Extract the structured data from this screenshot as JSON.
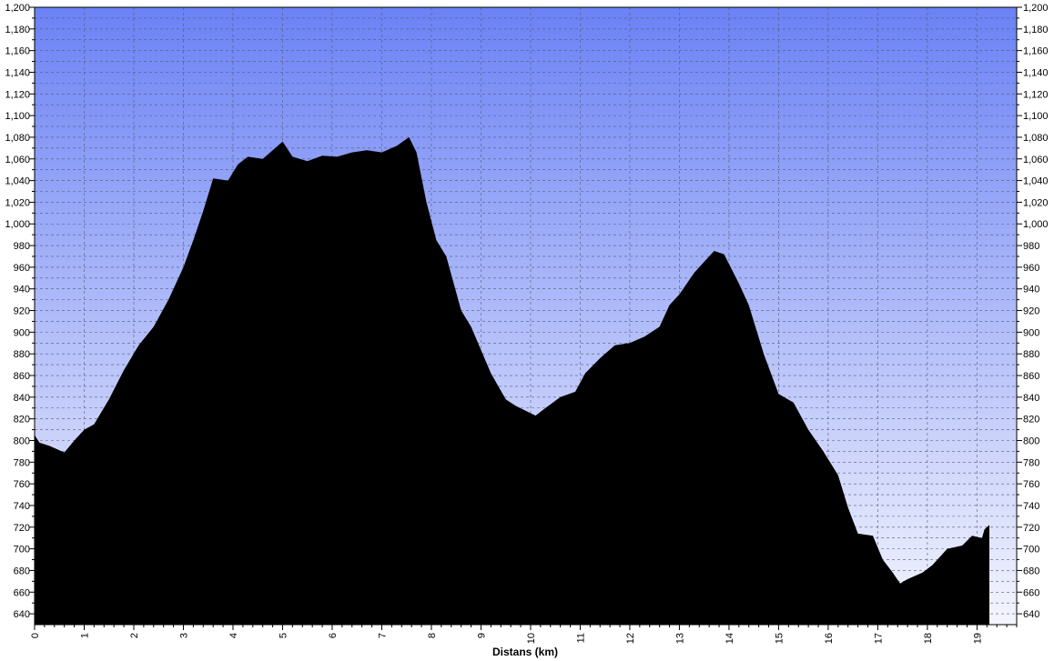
{
  "chart_data": {
    "type": "area",
    "title": "",
    "xlabel": "Distans (km)",
    "ylabel": "",
    "xlim": [
      0,
      19.8
    ],
    "ylim": [
      630,
      1200
    ],
    "x_ticks": [
      "0",
      "1",
      "2",
      "3",
      "4",
      "5",
      "6",
      "7",
      "8",
      "9",
      "10",
      "11",
      "12",
      "13",
      "14",
      "15",
      "16",
      "17",
      "18",
      "19"
    ],
    "y_ticks": [
      "640",
      "660",
      "680",
      "700",
      "720",
      "740",
      "760",
      "780",
      "800",
      "820",
      "840",
      "860",
      "880",
      "900",
      "920",
      "940",
      "960",
      "980",
      "1,000",
      "1,020",
      "1,040",
      "1,060",
      "1,080",
      "1,100",
      "1,120",
      "1,140",
      "1,160",
      "1,180",
      "1,200"
    ],
    "grid": true,
    "colors": {
      "background_top": "#6b82f5",
      "background_bottom": "#f4f5fd",
      "fill": "#000000"
    },
    "series": [
      {
        "x": [
          0,
          0.1,
          0.3,
          0.6,
          0.8,
          1.0,
          1.2,
          1.5,
          1.8,
          2.1,
          2.4,
          2.7,
          3.0,
          3.2,
          3.4,
          3.6,
          3.9,
          4.1,
          4.3,
          4.6,
          4.8,
          5.0,
          5.2,
          5.5,
          5.8,
          6.1,
          6.4,
          6.7,
          7.0,
          7.3,
          7.55,
          7.7,
          7.9,
          8.1,
          8.3,
          8.6,
          8.8,
          9.2,
          9.5,
          9.7,
          10.1,
          10.3,
          10.6,
          10.9,
          11.1,
          11.4,
          11.7,
          12.0,
          12.3,
          12.6,
          12.8,
          13.0,
          13.3,
          13.5,
          13.7,
          13.9,
          14.2,
          14.4,
          14.7,
          15.0,
          15.3,
          15.6,
          15.9,
          16.2,
          16.4,
          16.6,
          16.9,
          17.1,
          17.3,
          17.45,
          17.6,
          17.9,
          18.1,
          18.4,
          18.7,
          18.9,
          19.1,
          19.15,
          19.25
        ],
        "y": [
          805,
          798,
          795,
          789,
          800,
          810,
          815,
          838,
          865,
          888,
          905,
          930,
          960,
          985,
          1012,
          1042,
          1040,
          1055,
          1062,
          1060,
          1068,
          1076,
          1062,
          1058,
          1063,
          1062,
          1066,
          1068,
          1066,
          1072,
          1080,
          1066,
          1020,
          985,
          970,
          920,
          905,
          862,
          838,
          832,
          823,
          830,
          840,
          845,
          862,
          876,
          888,
          890,
          896,
          905,
          925,
          935,
          955,
          965,
          975,
          972,
          945,
          925,
          880,
          843,
          835,
          810,
          790,
          768,
          738,
          714,
          712,
          690,
          678,
          668,
          672,
          678,
          685,
          700,
          703,
          712,
          710,
          718,
          722
        ]
      }
    ]
  }
}
